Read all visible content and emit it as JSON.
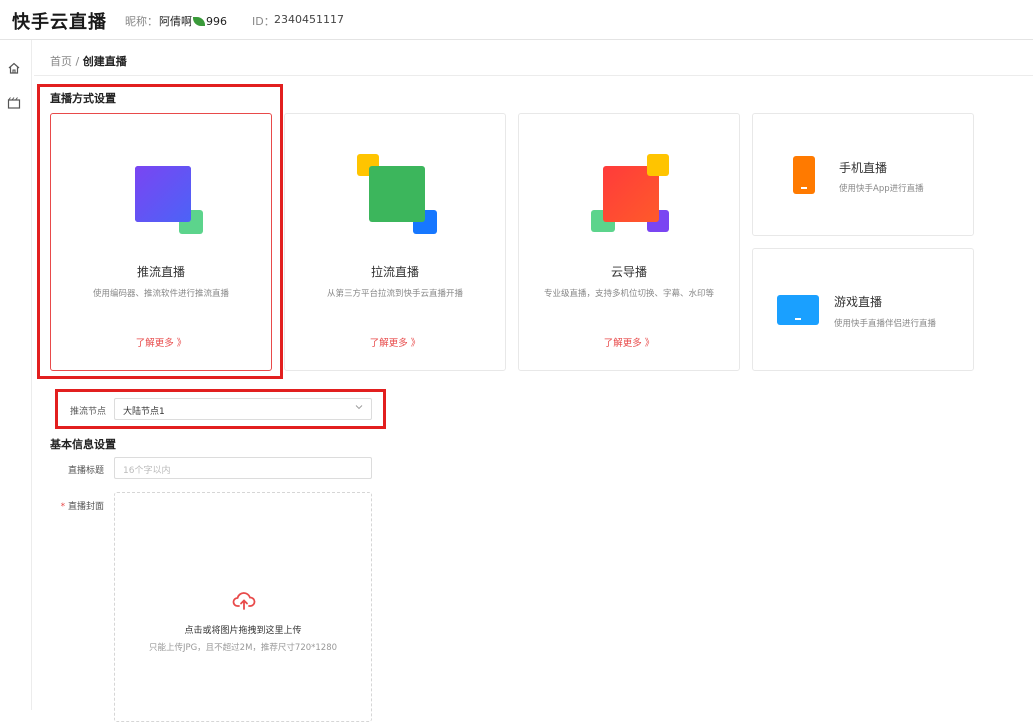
{
  "header": {
    "logo": "快手云直播",
    "nickname_label": "昵称：",
    "nickname_before": "阿倩啊",
    "nickname_after": "996",
    "id_label": "ID：",
    "id_value": "2340451117"
  },
  "sidebar": {
    "items": [
      {
        "icon": "home-icon"
      },
      {
        "icon": "video-icon"
      }
    ]
  },
  "breadcrumb": {
    "home": "首页",
    "separator": " / ",
    "current": "创建直播"
  },
  "live_mode": {
    "section_title": "直播方式设置",
    "cards": [
      {
        "title": "推流直播",
        "desc": "使用编码器、推流软件进行推流直播",
        "more": "了解更多 》",
        "selected": true
      },
      {
        "title": "拉流直播",
        "desc": "从第三方平台拉流到快手云直播开播",
        "more": "了解更多 》",
        "selected": false
      },
      {
        "title": "云导播",
        "desc": "专业级直播，支持多机位切换、字幕、水印等",
        "more": "了解更多 》",
        "selected": false
      }
    ],
    "small_cards": [
      {
        "title": "手机直播",
        "desc": "使用快手App进行直播"
      },
      {
        "title": "游戏直播",
        "desc": "使用快手直播伴侣进行直播"
      }
    ]
  },
  "push_node": {
    "label": "推流节点",
    "value": "大陆节点1"
  },
  "basic_info": {
    "section_title": "基本信息设置",
    "title_label": "直播标题",
    "title_placeholder": "16个字以内",
    "cover_required": "*",
    "cover_label": "直播封面",
    "upload_title": "点击或将图片拖拽到这里上传",
    "upload_hint": "只能上传JPG，且不超过2M，推荐尺寸720*1280"
  },
  "colors": {
    "accent": "#e84a4a",
    "highlight_box": "#e21f1f"
  }
}
